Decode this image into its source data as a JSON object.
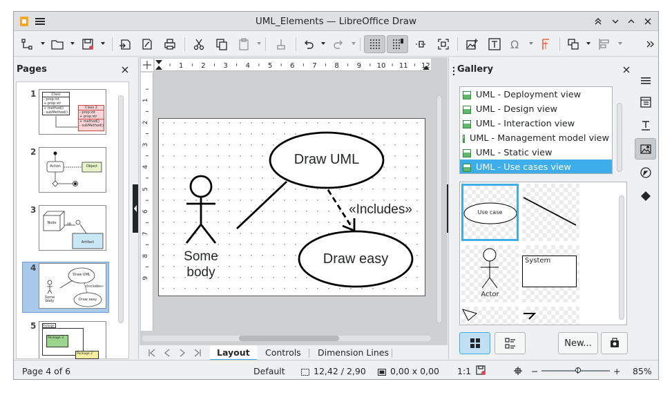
{
  "window": {
    "title": "UML_Elements — LibreOffice Draw"
  },
  "pages_panel": {
    "title": "Pages",
    "thumbnails": [
      {
        "number": "1",
        "class_label": "Class",
        "class_attrs": [
          "- prop:int",
          "+ prop:str"
        ],
        "class_methods": [
          "+ method()",
          "- subMethod()"
        ],
        "class2_label": "Class 2"
      },
      {
        "number": "2",
        "action_label": "Action",
        "object_label": "Object"
      },
      {
        "number": "3",
        "node_label": "Node",
        "api_label": "API",
        "artifact_label": "Artifact"
      },
      {
        "number": "4",
        "draw_uml": "Draw UML",
        "includes": "«Includes»",
        "draw_easy": "Draw easy",
        "actor": "Some body"
      },
      {
        "number": "5",
        "package_label": "Package",
        "package3_label": "Package 3",
        "package2_label": "Package 2"
      }
    ]
  },
  "rulers": {
    "horizontal": [
      "1",
      "2",
      "3",
      "4",
      "5",
      "6",
      "7",
      "8",
      "9",
      "10",
      "11",
      "12"
    ],
    "vertical": [
      "1",
      "2",
      "3",
      "4",
      "5",
      "6",
      "7",
      "8",
      "9"
    ]
  },
  "canvas": {
    "actor_line1": "Some",
    "actor_line2": "body",
    "usecase1": "Draw UML",
    "usecase2": "Draw easy",
    "stereotype": "«Includes»"
  },
  "tabs": [
    "Layout",
    "Controls",
    "Dimension Lines"
  ],
  "gallery": {
    "title": "Gallery",
    "themes": [
      "UML - Deployment view",
      "UML - Design view",
      "UML - Interaction view",
      "UML - Management model view",
      "UML - Static view",
      "UML - Use cases view"
    ],
    "selected_theme_index": 5,
    "preview_labels": {
      "use_case": "Use case",
      "system": "System",
      "actor": "Actor"
    },
    "new_button": "New..."
  },
  "status": {
    "page": "Page 4 of 6",
    "layout": "Default",
    "position": "12,42 / 2,90",
    "size": "0,00 x 0,00",
    "scale": "1:1",
    "zoom_level": "85%"
  },
  "colors": {
    "accent": "#3daee9",
    "selection": "#a7c9ea"
  }
}
